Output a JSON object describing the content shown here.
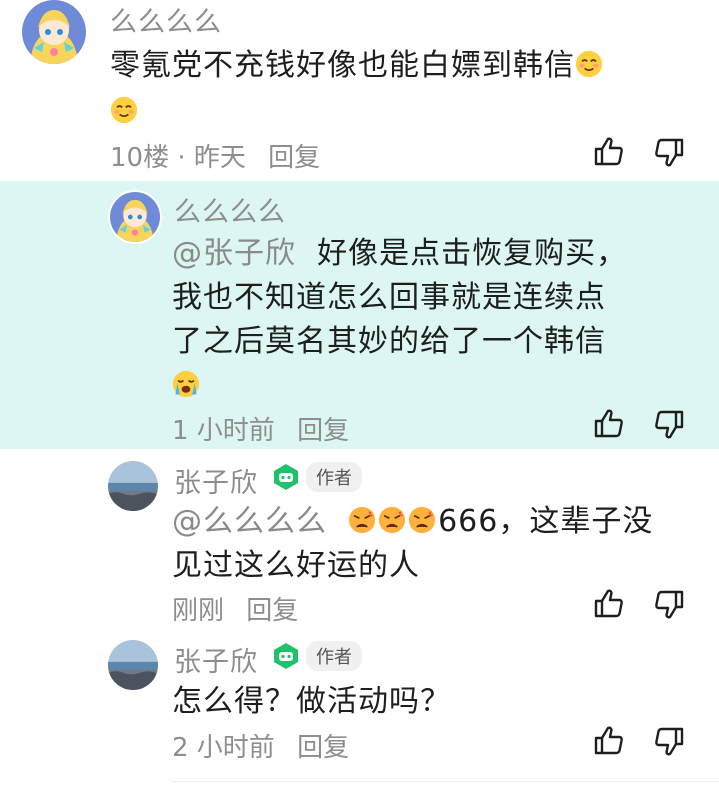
{
  "comments": [
    {
      "username": "么么么么",
      "text": "零氪党不充钱好像也能白嫖到韩信",
      "floor": "10楼",
      "sep": "·",
      "time": "昨天",
      "reply_label": "回复"
    },
    {
      "username": "么么么么",
      "mention": "@张子欣",
      "text_line1": "好像是点击恢复购买，",
      "text_line2": "我也不知道怎么回事就是连续点",
      "text_line3": "了之后莫名其妙的给了一个韩信",
      "time": "1 小时前",
      "reply_label": "回复"
    },
    {
      "username": "张子欣",
      "author_tag": "作者",
      "mention": "@么么么么",
      "text_line1_tail": "666，这辈子没",
      "text_line2": "见过这么好运的人",
      "time": "刚刚",
      "reply_label": "回复"
    },
    {
      "username": "张子欣",
      "author_tag": "作者",
      "text": "怎么得？做活动吗？",
      "time": "2 小时前",
      "reply_label": "回复"
    }
  ],
  "colors": {
    "highlight_bg": "#dcf6f3",
    "badge_green": "#1fc16b",
    "text": "#1e1e1e",
    "meta": "#8e8e8e"
  },
  "icons": [
    "thumbs-up-icon",
    "thumbs-down-icon",
    "relieved-emoji-icon",
    "crying-emoji-icon",
    "angry-emoji-icon",
    "game-controller-badge-icon"
  ]
}
